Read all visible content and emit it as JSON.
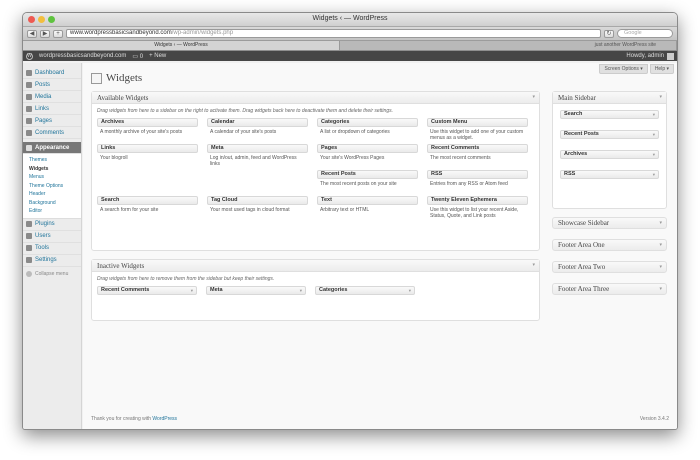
{
  "browser": {
    "window_title": "Widgets ‹ — WordPress",
    "url_host": "www.wordpressbasicsandbeyond.com",
    "url_path": "/wp-admin/widgets.php",
    "search_placeholder": "Google",
    "tabs": [
      {
        "label": "Widgets ‹ — WordPress"
      },
      {
        "label": "just another WordPress site"
      }
    ]
  },
  "adminbar": {
    "site_name": "wordpressbasicsandbeyond.com",
    "comments_count": "0",
    "new_label": "New",
    "howdy": "Howdy, admin"
  },
  "sidebar": {
    "items": [
      {
        "label": "Dashboard"
      },
      {
        "label": "Posts"
      },
      {
        "label": "Media"
      },
      {
        "label": "Links"
      },
      {
        "label": "Pages"
      },
      {
        "label": "Comments"
      },
      {
        "label": "Appearance"
      }
    ],
    "submenu": [
      "Themes",
      "Widgets",
      "Menus",
      "Theme Options",
      "Header",
      "Background",
      "Editor"
    ],
    "items2": [
      {
        "label": "Plugins"
      },
      {
        "label": "Users"
      },
      {
        "label": "Tools"
      },
      {
        "label": "Settings"
      }
    ],
    "collapse": "Collapse menu"
  },
  "main": {
    "screen_options": "Screen Options ▾",
    "help": "Help ▾",
    "title": "Widgets",
    "available": {
      "title": "Available Widgets",
      "description": "Drag widgets from here to a sidebar on the right to activate them. Drag widgets back here to deactivate them and delete their settings.",
      "widgets": [
        {
          "name": "Archives",
          "desc": "A monthly archive of your site's posts"
        },
        {
          "name": "Calendar",
          "desc": "A calendar of your site's posts"
        },
        {
          "name": "Categories",
          "desc": "A list or dropdown of categories"
        },
        {
          "name": "Custom Menu",
          "desc": "Use this widget to add one of your custom menus as a widget."
        },
        {
          "name": "Links",
          "desc": "Your blogroll"
        },
        {
          "name": "Meta",
          "desc": "Log in/out, admin, feed and WordPress links"
        },
        {
          "name": "Pages",
          "desc": "Your site's WordPress Pages"
        },
        {
          "name": "Recent Comments",
          "desc": "The most recent comments"
        },
        {
          "name": "",
          "desc": ""
        },
        {
          "name": "",
          "desc": ""
        },
        {
          "name": "Recent Posts",
          "desc": "The most recent posts on your site"
        },
        {
          "name": "RSS",
          "desc": "Entries from any RSS or Atom feed"
        },
        {
          "name": "Search",
          "desc": "A search form for your site"
        },
        {
          "name": "Tag Cloud",
          "desc": "Your most used tags in cloud format"
        },
        {
          "name": "Text",
          "desc": "Arbitrary text or HTML"
        },
        {
          "name": "Twenty Eleven Ephemera",
          "desc": "Use this widget to list your recent Aside, Status, Quote, and Link posts"
        }
      ]
    },
    "inactive": {
      "title": "Inactive Widgets",
      "description": "Drag widgets from here to remove them from the sidebar but keep their settings.",
      "widgets": [
        "Recent Comments",
        "Meta",
        "Categories"
      ]
    },
    "main_sidebar": {
      "title": "Main Sidebar",
      "widgets": [
        "Search",
        "Recent Posts",
        "Archives",
        "RSS"
      ]
    },
    "other_sidebars": [
      "Showcase Sidebar",
      "Footer Area One",
      "Footer Area Two",
      "Footer Area Three"
    ],
    "footer": {
      "thanks_prefix": "Thank you for creating with ",
      "thanks_link": "WordPress",
      "version": "Version 3.4.2"
    }
  }
}
